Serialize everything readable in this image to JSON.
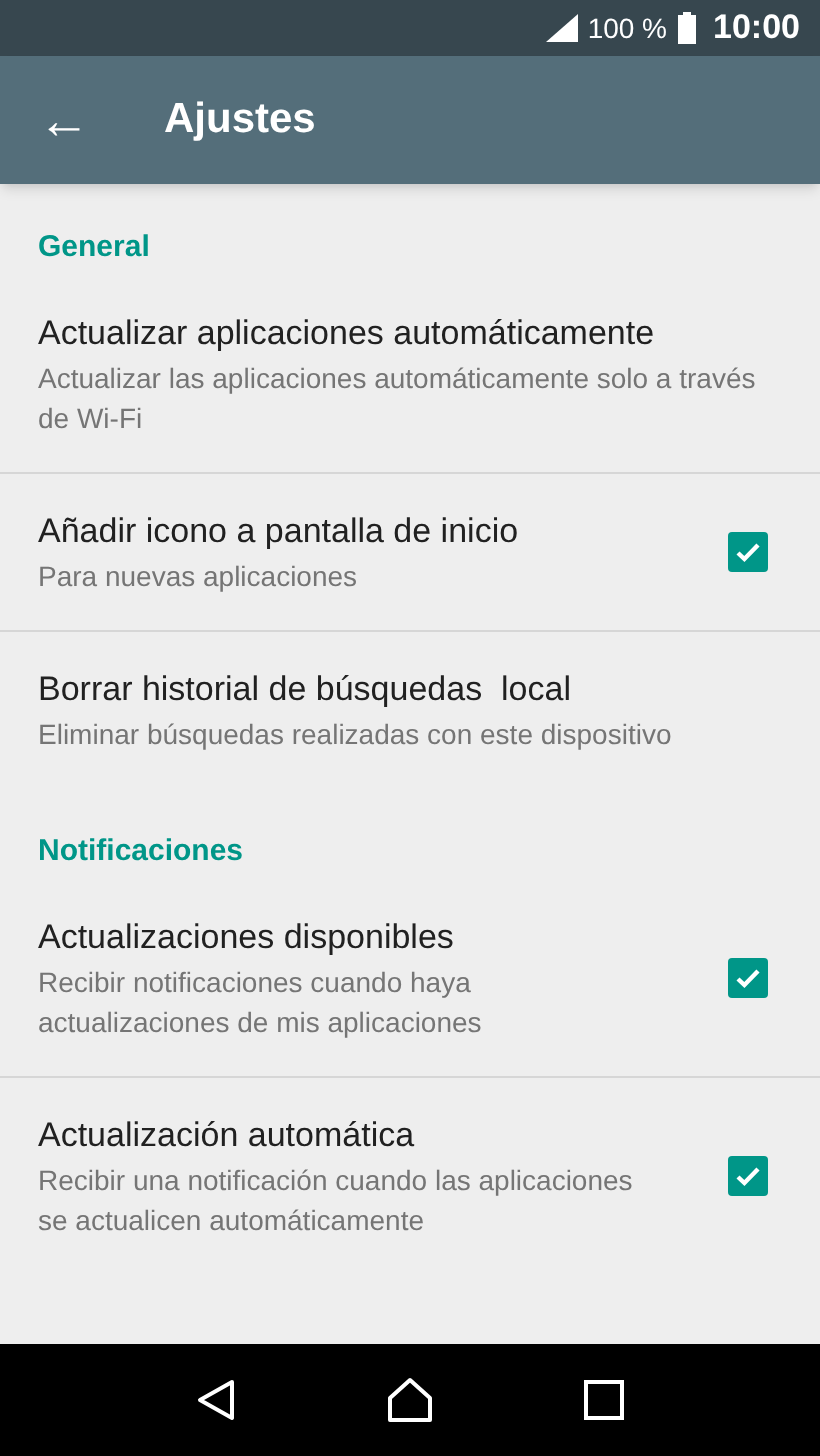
{
  "status_bar": {
    "battery": "100 %",
    "time": "10:00"
  },
  "app_bar": {
    "back": "←",
    "title": "Ajustes"
  },
  "sections": [
    {
      "header": "General",
      "items": [
        {
          "kind": "text",
          "title": "Actualizar aplicaciones automáticamente",
          "subtitle": "Actualizar las aplicaciones automáticamente solo a través de Wi-Fi"
        },
        {
          "kind": "checkbox",
          "title": "Añadir icono a pantalla de inicio",
          "subtitle": "Para nuevas aplicaciones",
          "checked": true
        },
        {
          "kind": "text",
          "title": "Borrar historial de búsquedas  local",
          "subtitle": "Eliminar búsquedas realizadas con este dispositivo"
        }
      ]
    },
    {
      "header": "Notificaciones",
      "items": [
        {
          "kind": "checkbox",
          "title": "Actualizaciones disponibles",
          "subtitle": "Recibir notificaciones cuando haya actualizaciones de mis aplicaciones",
          "checked": true
        },
        {
          "kind": "checkbox",
          "title": "Actualización automática",
          "subtitle": "Recibir una notificación cuando las aplicaciones se actualicen automáticamente",
          "checked": true
        }
      ]
    }
  ]
}
